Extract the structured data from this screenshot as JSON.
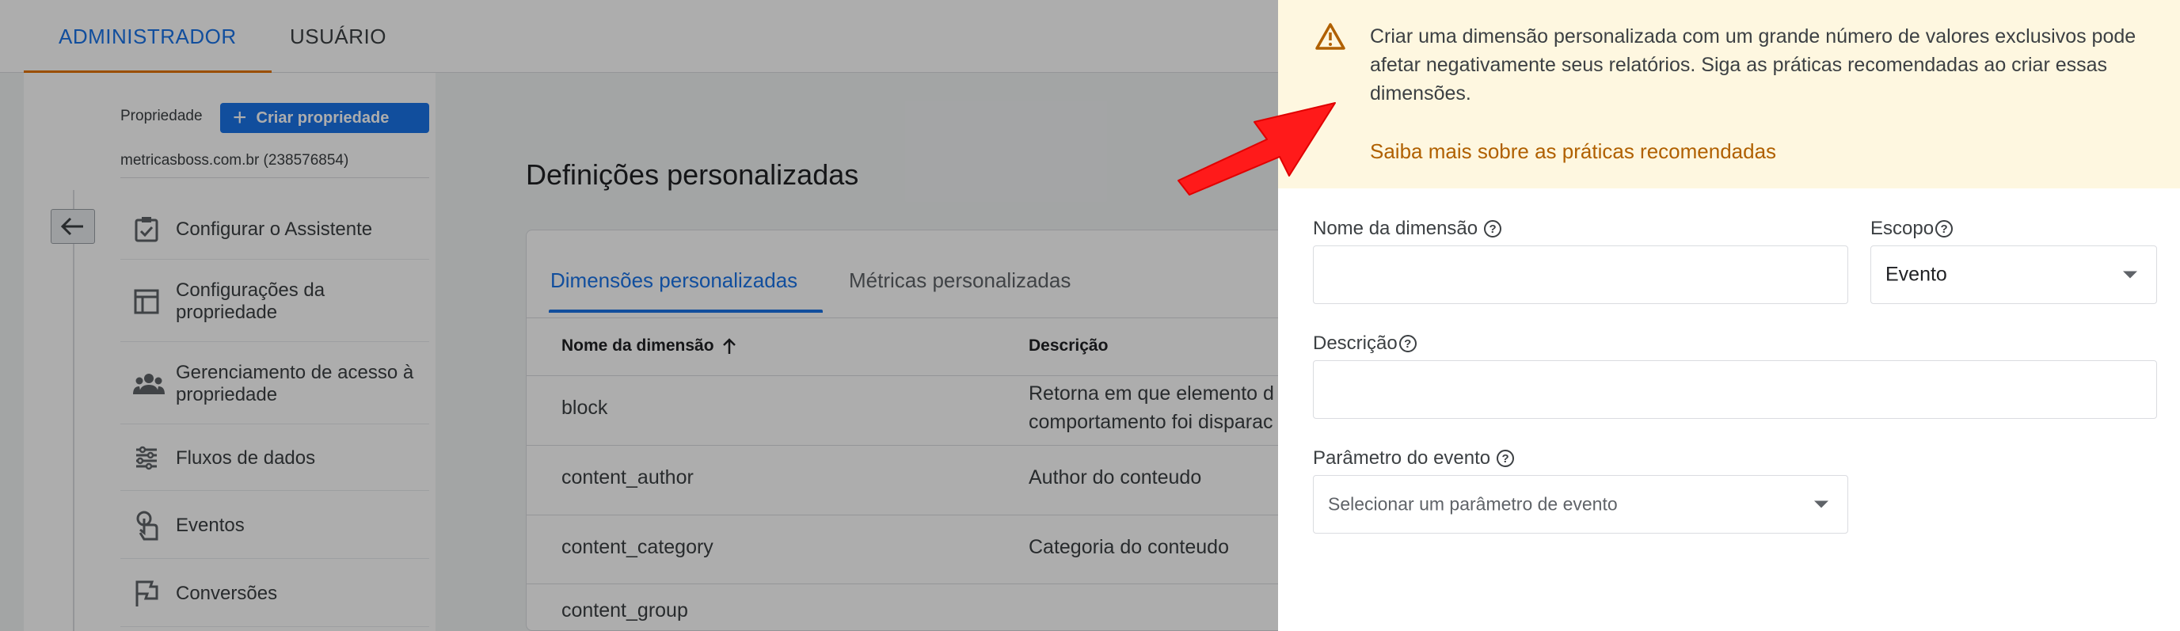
{
  "top_tabs": {
    "admin": "ADMINISTRADOR",
    "user": "USUÁRIO"
  },
  "property": {
    "label": "Propriedade",
    "create_button": "Criar propriedade",
    "account": "metricasboss.com.br (238576854)"
  },
  "nav": {
    "items": [
      {
        "label": "Configurar o Assistente",
        "icon": "checklist-icon"
      },
      {
        "label": "Configurações da propriedade",
        "icon": "layout-icon"
      },
      {
        "label": "Gerenciamento de acesso à propriedade",
        "icon": "people-icon"
      },
      {
        "label": "Fluxos de dados",
        "icon": "streams-icon"
      },
      {
        "label": "Eventos",
        "icon": "touch-icon"
      },
      {
        "label": "Conversões",
        "icon": "flag-icon"
      }
    ]
  },
  "main": {
    "title": "Definições personalizadas",
    "tabs": [
      "Dimensões personalizadas",
      "Métricas personalizadas"
    ],
    "columns": [
      "Nome da dimensão",
      "Descrição"
    ],
    "rows": [
      {
        "name": "block",
        "description_line1": "Retorna em que elemento d",
        "description_line2": "comportamento foi disparac"
      },
      {
        "name": "content_author",
        "description_line1": "Author do conteudo",
        "description_line2": ""
      },
      {
        "name": "content_category",
        "description_line1": "Categoria do conteudo",
        "description_line2": ""
      },
      {
        "name": "content_group",
        "description_line1": "",
        "description_line2": ""
      }
    ]
  },
  "panel": {
    "warning_text": "Criar uma dimensão personalizada com um grande número de valores exclusivos pode afetar negativamente seus relatórios. Siga as práticas recomendadas ao criar essas dimensões.",
    "warning_link": "Saiba mais sobre as práticas recomendadas",
    "dimension_name_label": "Nome da dimensão",
    "dimension_name_value": "",
    "scope_label": "Escopo",
    "scope_value": "Evento",
    "description_label": "Descrição",
    "description_value": "",
    "event_param_label": "Parâmetro do evento",
    "event_param_placeholder": "Selecionar um parâmetro de evento"
  },
  "colors": {
    "accent": "#1a73e8",
    "tab_indicator": "#e37400",
    "warning_bg": "#fef7e0",
    "warning_link": "#b06000",
    "annotation_arrow": "#ff1a1a"
  }
}
